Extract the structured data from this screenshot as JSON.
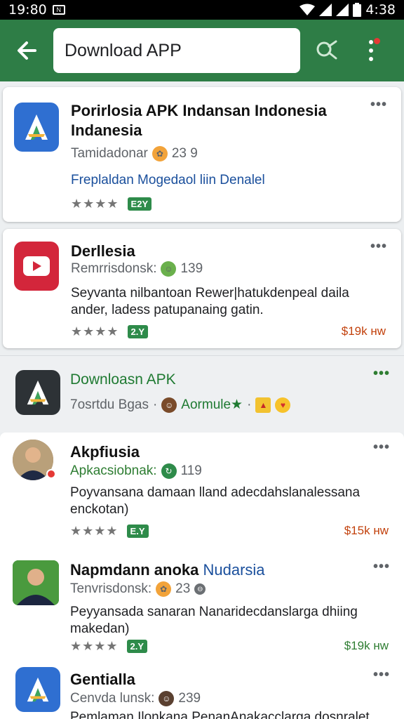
{
  "status_bar": {
    "time": "19:80",
    "notif_icon": "N",
    "battery_time": "4:38"
  },
  "app_bar": {
    "search_text": "Download APP"
  },
  "results": [
    {
      "title": "Porirlosia APK Indansan Indonesia Indanesia",
      "subtitle": "Tamidadonar",
      "count": "23 9",
      "link": "Freplaldan Mogedaol liin Denalel",
      "stars": "★★★★",
      "tag": "E2Y",
      "icon": "android-studio-icon",
      "menu": "•••"
    },
    {
      "title": "Derllesia",
      "subtitle": "Remrrisdonsk:",
      "count": "139",
      "desc": "Seyvanta nilbantoan Rewer|hatukdenpeal daila ander, ladess patupanaing gatin.",
      "stars": "★★★★",
      "tag": "2.Y",
      "price": "$19k нw",
      "icon": "youtube-icon",
      "menu": "•••"
    },
    {
      "title": "Downloasn APK",
      "subtitle": "7osrtdu Bgas",
      "author": "Aormule★",
      "icon": "android-icon",
      "menu": "•••"
    },
    {
      "title": "Akpfiusia",
      "subtitle": "Apkacsiobnak:",
      "count": "119",
      "desc": "Poyvansana damaan lland adecdahslanalessana enckotan)",
      "stars": "★★★★",
      "tag": "E.Y",
      "price": "$15k нw",
      "menu": "•••"
    },
    {
      "title": "Napmdann anoka",
      "title_highlight": "Nudarsia",
      "subtitle": "Tenvrisdonsk:",
      "count": "23",
      "desc": "Peyyansada sanaran Nanaridecdanslarga dhiing makedan)",
      "stars": "★★★★",
      "tag": "2.Y",
      "price": "$19k нw",
      "menu": "•••"
    },
    {
      "title": "Gentialla",
      "subtitle": "Cenvda lunsk:",
      "count": "239",
      "desc": "Pemlaman Ilonkana PenanAnakacclarga dosnralet",
      "icon": "android-studio-icon",
      "menu": "•••"
    }
  ],
  "colors": {
    "primary": "#2e7d46",
    "price_orange": "#c2410c",
    "link_blue": "#1a4f9c"
  }
}
